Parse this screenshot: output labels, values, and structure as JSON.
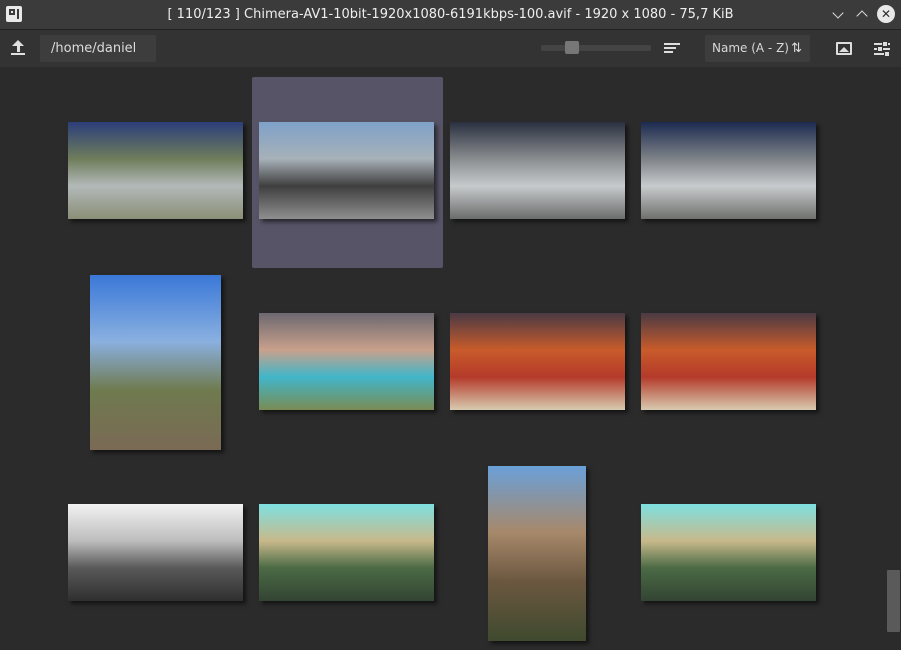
{
  "window": {
    "title": "[ 110/123 ] Chimera-AV1-10bit-1920x1080-6191kbps-100.avif - 1920 x 1080 - 75,7 KiB",
    "close_glyph": "✕"
  },
  "toolbar": {
    "path": "/home/daniel",
    "sort_label": "Name (A - Z)",
    "sort_icon": "sort-arrows-icon",
    "zoom_slider_level": 0.25
  },
  "thumbnails": [
    {
      "name": "thumb-fountain-sculpture",
      "colors": [
        "#2b3e7a",
        "#6f7d5b",
        "#b3b9b9",
        "#8a8f77"
      ]
    },
    {
      "name": "thumb-highway-cars",
      "colors": [
        "#7fa1c9",
        "#a6b1b8",
        "#3f3f3f",
        "#8f8f8f"
      ]
    },
    {
      "name": "thumb-fountain-child-1",
      "colors": [
        "#2a3040",
        "#8a8d8f",
        "#c7cacc",
        "#6b6d6b"
      ]
    },
    {
      "name": "thumb-fountain-child-2",
      "colors": [
        "#1c2a50",
        "#7e8388",
        "#c8cbcd",
        "#6f706d"
      ]
    },
    {
      "name": "thumb-hillside-landscape",
      "colors": [
        "#3a78d8",
        "#8ab0e0",
        "#6f7a4e",
        "#7a6a55"
      ]
    },
    {
      "name": "thumb-girls-portrait",
      "colors": [
        "#6c6870",
        "#c9a08b",
        "#41b6c9",
        "#7a8b53"
      ]
    },
    {
      "name": "thumb-spice-market-1",
      "colors": [
        "#4a3a44",
        "#c95b2b",
        "#b43a2a",
        "#d8cbb0"
      ]
    },
    {
      "name": "thumb-spice-market-2",
      "colors": [
        "#4a3a44",
        "#c95b2b",
        "#b43a2a",
        "#d8cbb0"
      ]
    },
    {
      "name": "thumb-church-grayscale",
      "colors": [
        "#f2f2f2",
        "#bdbdbd",
        "#595959",
        "#2f2f2f"
      ]
    },
    {
      "name": "thumb-church-color-1",
      "colors": [
        "#7ee0e0",
        "#c8b98a",
        "#4b6a45",
        "#334433"
      ]
    },
    {
      "name": "thumb-cliff-canyon",
      "colors": [
        "#6aa0d8",
        "#a7886a",
        "#6b5740",
        "#3f4a2e"
      ]
    },
    {
      "name": "thumb-church-color-2",
      "colors": [
        "#7ee0e0",
        "#c8b98a",
        "#4b6a45",
        "#334433"
      ]
    }
  ]
}
